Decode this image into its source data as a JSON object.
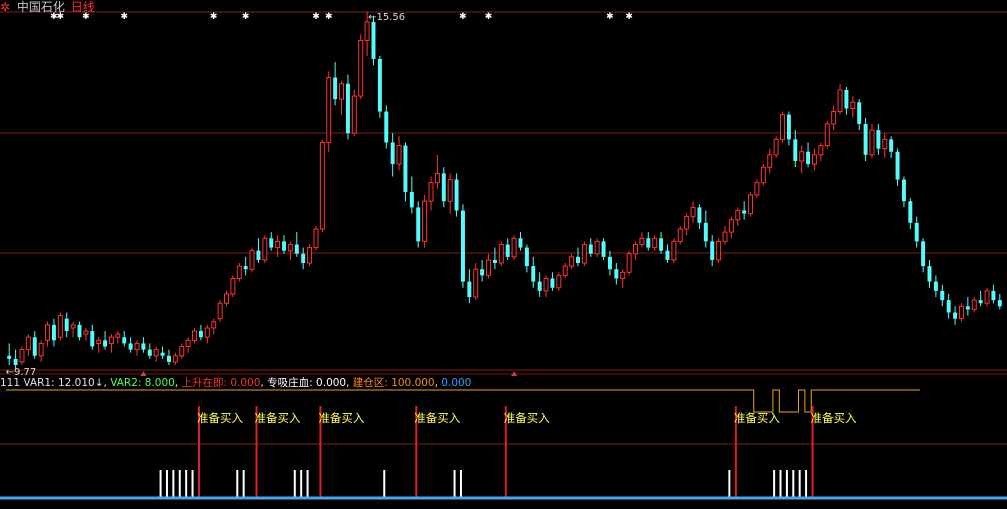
{
  "header": {
    "logo_icon": "gear-icon",
    "stock_name": "中国石化",
    "period": "日线"
  },
  "colors": {
    "background": "#000000",
    "up": "#ff3232",
    "down": "#54fcfc",
    "grid": "#8b1a1a",
    "marker": "#ffffff",
    "label": "#ffff54",
    "var1": "#e0e0e0",
    "var2": "#54fc54",
    "rise": "#ff3232",
    "absorb": "#ffffff",
    "build": "#ff8c00",
    "last": "#3399ff",
    "bottom_line": "#3fa9f5",
    "step_line": "#e8a417"
  },
  "price_chart": {
    "high_label": "15.56",
    "low_label": "9.77",
    "high_marker": "←",
    "low_marker": "←",
    "candles": [
      {
        "o": 10.0,
        "h": 10.2,
        "l": 9.85,
        "c": 9.95
      },
      {
        "o": 9.95,
        "h": 10.1,
        "l": 9.77,
        "c": 9.85
      },
      {
        "o": 9.9,
        "h": 10.15,
        "l": 9.85,
        "c": 10.1
      },
      {
        "o": 10.1,
        "h": 10.35,
        "l": 10.0,
        "c": 10.3
      },
      {
        "o": 10.3,
        "h": 10.4,
        "l": 9.95,
        "c": 10.0
      },
      {
        "o": 10.0,
        "h": 10.25,
        "l": 9.9,
        "c": 10.2
      },
      {
        "o": 10.25,
        "h": 10.55,
        "l": 10.15,
        "c": 10.5
      },
      {
        "o": 10.5,
        "h": 10.6,
        "l": 10.15,
        "c": 10.25
      },
      {
        "o": 10.3,
        "h": 10.7,
        "l": 10.25,
        "c": 10.65
      },
      {
        "o": 10.6,
        "h": 10.7,
        "l": 10.3,
        "c": 10.4
      },
      {
        "o": 10.45,
        "h": 10.55,
        "l": 10.3,
        "c": 10.5
      },
      {
        "o": 10.5,
        "h": 10.55,
        "l": 10.25,
        "c": 10.3
      },
      {
        "o": 10.35,
        "h": 10.45,
        "l": 10.25,
        "c": 10.4
      },
      {
        "o": 10.4,
        "h": 10.5,
        "l": 10.1,
        "c": 10.15
      },
      {
        "o": 10.2,
        "h": 10.3,
        "l": 10.05,
        "c": 10.25
      },
      {
        "o": 10.25,
        "h": 10.4,
        "l": 10.1,
        "c": 10.15
      },
      {
        "o": 10.2,
        "h": 10.35,
        "l": 10.05,
        "c": 10.3
      },
      {
        "o": 10.3,
        "h": 10.4,
        "l": 10.2,
        "c": 10.35
      },
      {
        "o": 10.3,
        "h": 10.4,
        "l": 10.15,
        "c": 10.2
      },
      {
        "o": 10.2,
        "h": 10.3,
        "l": 10.05,
        "c": 10.1
      },
      {
        "o": 10.1,
        "h": 10.25,
        "l": 10.0,
        "c": 10.2
      },
      {
        "o": 10.2,
        "h": 10.3,
        "l": 10.05,
        "c": 10.1
      },
      {
        "o": 10.1,
        "h": 10.2,
        "l": 9.95,
        "c": 10.0
      },
      {
        "o": 10.0,
        "h": 10.15,
        "l": 9.9,
        "c": 10.1
      },
      {
        "o": 10.05,
        "h": 10.15,
        "l": 9.95,
        "c": 10.0
      },
      {
        "o": 10.0,
        "h": 10.1,
        "l": 9.85,
        "c": 9.9
      },
      {
        "o": 9.9,
        "h": 10.05,
        "l": 9.85,
        "c": 10.0
      },
      {
        "o": 10.0,
        "h": 10.2,
        "l": 9.95,
        "c": 10.15
      },
      {
        "o": 10.15,
        "h": 10.3,
        "l": 10.05,
        "c": 10.25
      },
      {
        "o": 10.25,
        "h": 10.45,
        "l": 10.2,
        "c": 10.4
      },
      {
        "o": 10.4,
        "h": 10.5,
        "l": 10.25,
        "c": 10.3
      },
      {
        "o": 10.3,
        "h": 10.5,
        "l": 10.2,
        "c": 10.45
      },
      {
        "o": 10.45,
        "h": 10.6,
        "l": 10.35,
        "c": 10.55
      },
      {
        "o": 10.6,
        "h": 10.9,
        "l": 10.55,
        "c": 10.85
      },
      {
        "o": 10.85,
        "h": 11.05,
        "l": 10.8,
        "c": 11.0
      },
      {
        "o": 11.0,
        "h": 11.3,
        "l": 10.95,
        "c": 11.25
      },
      {
        "o": 11.25,
        "h": 11.5,
        "l": 11.2,
        "c": 11.45
      },
      {
        "o": 11.45,
        "h": 11.6,
        "l": 11.3,
        "c": 11.4
      },
      {
        "o": 11.4,
        "h": 11.75,
        "l": 11.35,
        "c": 11.7
      },
      {
        "o": 11.7,
        "h": 11.9,
        "l": 11.5,
        "c": 11.55
      },
      {
        "o": 11.55,
        "h": 11.95,
        "l": 11.5,
        "c": 11.9
      },
      {
        "o": 11.9,
        "h": 12.0,
        "l": 11.7,
        "c": 11.75
      },
      {
        "o": 11.75,
        "h": 11.95,
        "l": 11.6,
        "c": 11.85
      },
      {
        "o": 11.85,
        "h": 11.95,
        "l": 11.65,
        "c": 11.7
      },
      {
        "o": 11.7,
        "h": 11.85,
        "l": 11.55,
        "c": 11.8
      },
      {
        "o": 11.8,
        "h": 12.0,
        "l": 11.6,
        "c": 11.65
      },
      {
        "o": 11.65,
        "h": 11.75,
        "l": 11.4,
        "c": 11.5
      },
      {
        "o": 11.5,
        "h": 11.8,
        "l": 11.45,
        "c": 11.75
      },
      {
        "o": 11.75,
        "h": 12.1,
        "l": 11.7,
        "c": 12.05
      },
      {
        "o": 12.05,
        "h": 13.5,
        "l": 12.0,
        "c": 13.45
      },
      {
        "o": 13.45,
        "h": 14.6,
        "l": 13.3,
        "c": 14.5
      },
      {
        "o": 14.5,
        "h": 14.75,
        "l": 14.05,
        "c": 14.15
      },
      {
        "o": 14.15,
        "h": 14.45,
        "l": 13.9,
        "c": 14.4
      },
      {
        "o": 14.4,
        "h": 14.55,
        "l": 13.5,
        "c": 13.6
      },
      {
        "o": 13.6,
        "h": 14.3,
        "l": 13.55,
        "c": 14.2
      },
      {
        "o": 14.2,
        "h": 15.2,
        "l": 14.15,
        "c": 15.1
      },
      {
        "o": 15.1,
        "h": 15.56,
        "l": 14.85,
        "c": 15.4
      },
      {
        "o": 15.4,
        "h": 15.5,
        "l": 14.7,
        "c": 14.8
      },
      {
        "o": 14.8,
        "h": 14.85,
        "l": 13.85,
        "c": 13.95
      },
      {
        "o": 13.95,
        "h": 14.05,
        "l": 13.35,
        "c": 13.45
      },
      {
        "o": 13.45,
        "h": 13.6,
        "l": 12.9,
        "c": 13.1
      },
      {
        "o": 13.1,
        "h": 13.55,
        "l": 13.0,
        "c": 13.4
      },
      {
        "o": 13.4,
        "h": 13.45,
        "l": 12.5,
        "c": 12.65
      },
      {
        "o": 12.65,
        "h": 12.9,
        "l": 12.3,
        "c": 12.4
      },
      {
        "o": 12.4,
        "h": 12.5,
        "l": 11.75,
        "c": 11.85
      },
      {
        "o": 11.85,
        "h": 12.6,
        "l": 11.75,
        "c": 12.5
      },
      {
        "o": 12.5,
        "h": 12.9,
        "l": 12.35,
        "c": 12.8
      },
      {
        "o": 12.8,
        "h": 13.25,
        "l": 12.7,
        "c": 12.95
      },
      {
        "o": 12.95,
        "h": 13.05,
        "l": 12.4,
        "c": 12.5
      },
      {
        "o": 12.5,
        "h": 12.95,
        "l": 12.3,
        "c": 12.85
      },
      {
        "o": 12.85,
        "h": 12.95,
        "l": 12.25,
        "c": 12.35
      },
      {
        "o": 12.35,
        "h": 12.45,
        "l": 11.1,
        "c": 11.2
      },
      {
        "o": 11.2,
        "h": 11.4,
        "l": 10.85,
        "c": 10.95
      },
      {
        "o": 10.95,
        "h": 11.5,
        "l": 10.9,
        "c": 11.4
      },
      {
        "o": 11.4,
        "h": 11.55,
        "l": 11.2,
        "c": 11.3
      },
      {
        "o": 11.3,
        "h": 11.65,
        "l": 11.25,
        "c": 11.55
      },
      {
        "o": 11.55,
        "h": 11.75,
        "l": 11.4,
        "c": 11.5
      },
      {
        "o": 11.5,
        "h": 11.85,
        "l": 11.45,
        "c": 11.8
      },
      {
        "o": 11.8,
        "h": 11.9,
        "l": 11.55,
        "c": 11.6
      },
      {
        "o": 11.6,
        "h": 11.95,
        "l": 11.55,
        "c": 11.9
      },
      {
        "o": 11.9,
        "h": 12.0,
        "l": 11.7,
        "c": 11.75
      },
      {
        "o": 11.75,
        "h": 11.8,
        "l": 11.35,
        "c": 11.45
      },
      {
        "o": 11.45,
        "h": 11.6,
        "l": 11.1,
        "c": 11.2
      },
      {
        "o": 11.2,
        "h": 11.35,
        "l": 10.95,
        "c": 11.05
      },
      {
        "o": 11.05,
        "h": 11.3,
        "l": 10.95,
        "c": 11.25
      },
      {
        "o": 11.25,
        "h": 11.35,
        "l": 11.05,
        "c": 11.1
      },
      {
        "o": 11.1,
        "h": 11.35,
        "l": 11.05,
        "c": 11.3
      },
      {
        "o": 11.3,
        "h": 11.5,
        "l": 11.25,
        "c": 11.45
      },
      {
        "o": 11.45,
        "h": 11.65,
        "l": 11.4,
        "c": 11.6
      },
      {
        "o": 11.6,
        "h": 11.75,
        "l": 11.45,
        "c": 11.5
      },
      {
        "o": 11.5,
        "h": 11.85,
        "l": 11.45,
        "c": 11.8
      },
      {
        "o": 11.8,
        "h": 11.9,
        "l": 11.6,
        "c": 11.65
      },
      {
        "o": 11.65,
        "h": 11.9,
        "l": 11.6,
        "c": 11.85
      },
      {
        "o": 11.85,
        "h": 11.9,
        "l": 11.55,
        "c": 11.6
      },
      {
        "o": 11.6,
        "h": 11.7,
        "l": 11.3,
        "c": 11.4
      },
      {
        "o": 11.4,
        "h": 11.5,
        "l": 11.15,
        "c": 11.25
      },
      {
        "o": 11.25,
        "h": 11.4,
        "l": 11.1,
        "c": 11.35
      },
      {
        "o": 11.35,
        "h": 11.7,
        "l": 11.3,
        "c": 11.65
      },
      {
        "o": 11.65,
        "h": 11.85,
        "l": 11.55,
        "c": 11.8
      },
      {
        "o": 11.8,
        "h": 12.0,
        "l": 11.75,
        "c": 11.9
      },
      {
        "o": 11.9,
        "h": 12.0,
        "l": 11.7,
        "c": 11.75
      },
      {
        "o": 11.75,
        "h": 11.95,
        "l": 11.7,
        "c": 11.9
      },
      {
        "o": 11.9,
        "h": 12.0,
        "l": 11.65,
        "c": 11.7
      },
      {
        "o": 11.7,
        "h": 11.8,
        "l": 11.5,
        "c": 11.55
      },
      {
        "o": 11.55,
        "h": 11.9,
        "l": 11.5,
        "c": 11.85
      },
      {
        "o": 11.85,
        "h": 12.1,
        "l": 11.8,
        "c": 12.05
      },
      {
        "o": 12.05,
        "h": 12.3,
        "l": 11.95,
        "c": 12.25
      },
      {
        "o": 12.25,
        "h": 12.5,
        "l": 12.15,
        "c": 12.4
      },
      {
        "o": 12.4,
        "h": 12.45,
        "l": 12.05,
        "c": 12.15
      },
      {
        "o": 12.15,
        "h": 12.35,
        "l": 11.75,
        "c": 11.85
      },
      {
        "o": 11.85,
        "h": 11.95,
        "l": 11.45,
        "c": 11.55
      },
      {
        "o": 11.55,
        "h": 11.9,
        "l": 11.5,
        "c": 11.85
      },
      {
        "o": 11.85,
        "h": 12.1,
        "l": 11.8,
        "c": 12.0
      },
      {
        "o": 12.0,
        "h": 12.25,
        "l": 11.9,
        "c": 12.2
      },
      {
        "o": 12.2,
        "h": 12.4,
        "l": 12.1,
        "c": 12.35
      },
      {
        "o": 12.35,
        "h": 12.5,
        "l": 12.2,
        "c": 12.3
      },
      {
        "o": 12.3,
        "h": 12.65,
        "l": 12.25,
        "c": 12.6
      },
      {
        "o": 12.6,
        "h": 12.85,
        "l": 12.55,
        "c": 12.8
      },
      {
        "o": 12.8,
        "h": 13.1,
        "l": 12.75,
        "c": 13.05
      },
      {
        "o": 13.05,
        "h": 13.35,
        "l": 12.95,
        "c": 13.25
      },
      {
        "o": 13.25,
        "h": 13.55,
        "l": 13.2,
        "c": 13.5
      },
      {
        "o": 13.5,
        "h": 13.95,
        "l": 13.45,
        "c": 13.9
      },
      {
        "o": 13.9,
        "h": 13.95,
        "l": 13.4,
        "c": 13.5
      },
      {
        "o": 13.5,
        "h": 13.65,
        "l": 13.05,
        "c": 13.15
      },
      {
        "o": 13.15,
        "h": 13.4,
        "l": 12.95,
        "c": 13.3
      },
      {
        "o": 13.3,
        "h": 13.45,
        "l": 13.05,
        "c": 13.1
      },
      {
        "o": 13.1,
        "h": 13.35,
        "l": 13.0,
        "c": 13.25
      },
      {
        "o": 13.25,
        "h": 13.45,
        "l": 13.15,
        "c": 13.4
      },
      {
        "o": 13.4,
        "h": 13.8,
        "l": 13.35,
        "c": 13.75
      },
      {
        "o": 13.75,
        "h": 14.05,
        "l": 13.65,
        "c": 13.95
      },
      {
        "o": 13.95,
        "h": 14.4,
        "l": 13.9,
        "c": 14.3
      },
      {
        "o": 14.3,
        "h": 14.35,
        "l": 13.9,
        "c": 14.0
      },
      {
        "o": 14.0,
        "h": 14.2,
        "l": 13.85,
        "c": 14.1
      },
      {
        "o": 14.1,
        "h": 14.15,
        "l": 13.65,
        "c": 13.75
      },
      {
        "o": 13.75,
        "h": 13.85,
        "l": 13.15,
        "c": 13.25
      },
      {
        "o": 13.25,
        "h": 13.75,
        "l": 13.2,
        "c": 13.65
      },
      {
        "o": 13.65,
        "h": 13.75,
        "l": 13.25,
        "c": 13.35
      },
      {
        "o": 13.35,
        "h": 13.6,
        "l": 13.2,
        "c": 13.5
      },
      {
        "o": 13.5,
        "h": 13.55,
        "l": 13.2,
        "c": 13.3
      },
      {
        "o": 13.3,
        "h": 13.35,
        "l": 12.75,
        "c": 12.85
      },
      {
        "o": 12.85,
        "h": 12.9,
        "l": 12.4,
        "c": 12.5
      },
      {
        "o": 12.5,
        "h": 12.55,
        "l": 12.05,
        "c": 12.15
      },
      {
        "o": 12.15,
        "h": 12.25,
        "l": 11.75,
        "c": 11.85
      },
      {
        "o": 11.85,
        "h": 11.9,
        "l": 11.35,
        "c": 11.45
      },
      {
        "o": 11.45,
        "h": 11.55,
        "l": 11.1,
        "c": 11.2
      },
      {
        "o": 11.2,
        "h": 11.3,
        "l": 10.95,
        "c": 11.05
      },
      {
        "o": 11.05,
        "h": 11.15,
        "l": 10.8,
        "c": 10.9
      },
      {
        "o": 10.9,
        "h": 11.0,
        "l": 10.6,
        "c": 10.7
      },
      {
        "o": 10.7,
        "h": 10.8,
        "l": 10.5,
        "c": 10.6
      },
      {
        "o": 10.6,
        "h": 10.85,
        "l": 10.55,
        "c": 10.8
      },
      {
        "o": 10.8,
        "h": 10.95,
        "l": 10.65,
        "c": 10.75
      },
      {
        "o": 10.75,
        "h": 10.95,
        "l": 10.7,
        "c": 10.9
      },
      {
        "o": 10.9,
        "h": 11.05,
        "l": 10.8,
        "c": 10.85
      },
      {
        "o": 10.85,
        "h": 11.1,
        "l": 10.8,
        "c": 11.05
      },
      {
        "o": 11.05,
        "h": 11.15,
        "l": 10.85,
        "c": 10.9
      },
      {
        "o": 10.9,
        "h": 11.0,
        "l": 10.75,
        "c": 10.8
      }
    ],
    "markers": [
      {
        "bar": 7,
        "sym": "✱"
      },
      {
        "bar": 8,
        "sym": "✱"
      },
      {
        "bar": 12,
        "sym": "✱"
      },
      {
        "bar": 18,
        "sym": "✱"
      },
      {
        "bar": 32,
        "sym": "✱"
      },
      {
        "bar": 37,
        "sym": "✱"
      },
      {
        "bar": 48,
        "sym": "✱"
      },
      {
        "bar": 50,
        "sym": "✱"
      },
      {
        "bar": 71,
        "sym": "✱"
      },
      {
        "bar": 75,
        "sym": "✱"
      },
      {
        "bar": 94,
        "sym": "✱"
      },
      {
        "bar": 97,
        "sym": "✱"
      }
    ]
  },
  "indicator": {
    "prefix": "111",
    "var1_label": "VAR1:",
    "var1_value": "12.010",
    "var1_arrow": "↓",
    "var2_label": "VAR2:",
    "var2_value": "8.000",
    "rise_label": "上升在即:",
    "rise_value": "0.000",
    "absorb_label": "专吸庄血:",
    "absorb_value": "0.000",
    "build_label": "建仓区:",
    "build_value": "100.000",
    "last_value": "0.000",
    "signal_label": "准备买入",
    "signals": [
      {
        "bar": 30
      },
      {
        "bar": 39
      },
      {
        "bar": 49
      },
      {
        "bar": 64
      },
      {
        "bar": 78
      },
      {
        "bar": 114
      },
      {
        "bar": 126
      }
    ],
    "white_bars": [
      24,
      25,
      26,
      27,
      28,
      29,
      36,
      37,
      45,
      46,
      47,
      59,
      70,
      71,
      113,
      120,
      121,
      122,
      123,
      124,
      125
    ],
    "build_zone_steps": [
      {
        "from_bar": 0,
        "to_bar": 117,
        "level": 100
      },
      {
        "from_bar": 117,
        "to_bar": 120,
        "level": 0
      },
      {
        "from_bar": 120,
        "to_bar": 121,
        "level": 100
      },
      {
        "from_bar": 121,
        "to_bar": 124,
        "level": 0
      },
      {
        "from_bar": 124,
        "to_bar": 125,
        "level": 100
      },
      {
        "from_bar": 125,
        "to_bar": 126,
        "level": 0
      },
      {
        "from_bar": 126,
        "to_bar": 143,
        "level": 100
      }
    ]
  }
}
